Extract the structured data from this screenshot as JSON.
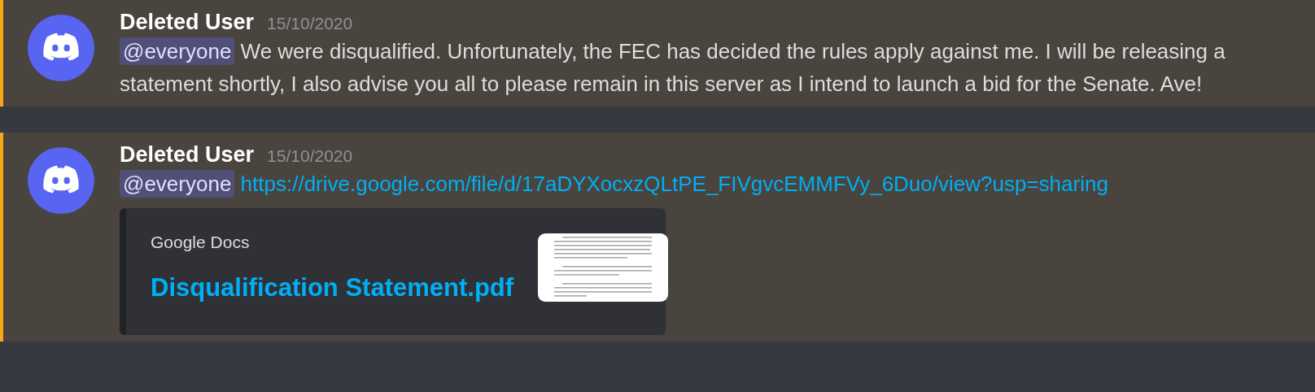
{
  "messages": [
    {
      "author": "Deleted User",
      "timestamp": "15/10/2020",
      "mentioned": true,
      "mention": "@everyone",
      "text": "We were disqualified. Unfortunately, the FEC has decided the rules apply against me. I will be releasing a statement shortly, I also advise you all to please remain in this server as I intend to launch a bid for the Senate. Ave!"
    },
    {
      "author": "Deleted User",
      "timestamp": "15/10/2020",
      "mentioned": true,
      "mention": "@everyone",
      "link": "https://drive.google.com/file/d/17aDYXocxzQLtPE_FIVgvcEMMFVy_6Duo/view?usp=sharing",
      "embed": {
        "provider": "Google Docs",
        "title": "Disqualification Statement.pdf"
      }
    }
  ]
}
